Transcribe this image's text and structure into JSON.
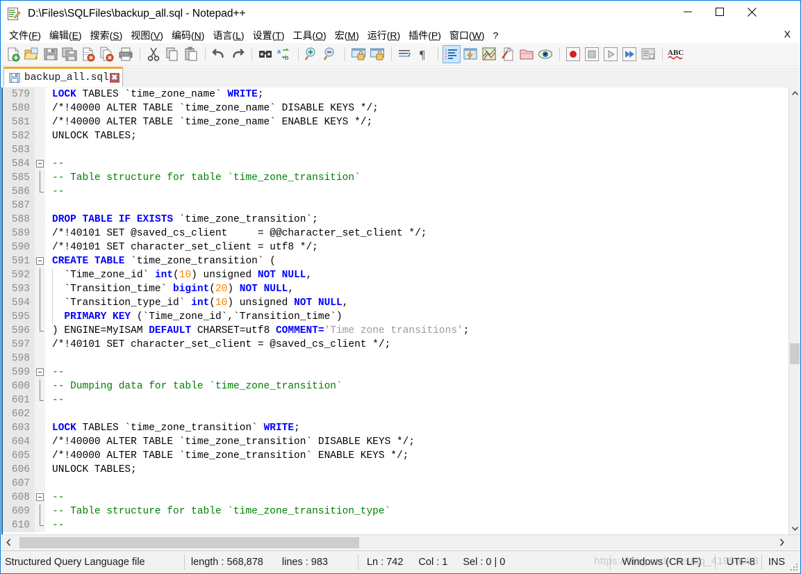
{
  "window": {
    "title": "D:\\Files\\SQLFiles\\backup_all.sql - Notepad++",
    "app_icon": "notepad-plus-plus-icon",
    "minimize_glyph": "—",
    "maximize_glyph": "☐",
    "close_glyph": "✕",
    "accent_color": "#0078d7"
  },
  "menu": {
    "items": [
      {
        "pre": "文件(",
        "key": "F",
        "post": ")"
      },
      {
        "pre": "编辑(",
        "key": "E",
        "post": ")"
      },
      {
        "pre": "搜索(",
        "key": "S",
        "post": ")"
      },
      {
        "pre": "视图(",
        "key": "V",
        "post": ")"
      },
      {
        "pre": "编码(",
        "key": "N",
        "post": ")"
      },
      {
        "pre": "语言(",
        "key": "L",
        "post": ")"
      },
      {
        "pre": "设置(",
        "key": "T",
        "post": ")"
      },
      {
        "pre": "工具(",
        "key": "O",
        "post": ")"
      },
      {
        "pre": "宏(",
        "key": "M",
        "post": ")"
      },
      {
        "pre": "运行(",
        "key": "R",
        "post": ")"
      },
      {
        "pre": "插件(",
        "key": "P",
        "post": ")"
      },
      {
        "pre": "窗口(",
        "key": "W",
        "post": ")"
      },
      {
        "pre": "?",
        "key": "",
        "post": ""
      }
    ],
    "close_document_label": "X"
  },
  "toolbar": {
    "buttons": [
      {
        "name": "new-file-icon",
        "group": 1
      },
      {
        "name": "open-file-icon",
        "group": 1
      },
      {
        "name": "save-icon",
        "group": 1
      },
      {
        "name": "save-all-icon",
        "group": 1
      },
      {
        "name": "close-file-icon",
        "group": 1
      },
      {
        "name": "close-all-files-icon",
        "group": 1
      },
      {
        "name": "print-icon",
        "group": 1
      },
      {
        "name": "cut-icon",
        "group": 2
      },
      {
        "name": "copy-icon",
        "group": 2
      },
      {
        "name": "paste-icon",
        "group": 2
      },
      {
        "name": "undo-icon",
        "group": 3
      },
      {
        "name": "redo-icon",
        "group": 3
      },
      {
        "name": "find-icon",
        "group": 4
      },
      {
        "name": "replace-icon",
        "group": 4
      },
      {
        "name": "zoom-in-icon",
        "group": 5
      },
      {
        "name": "zoom-out-icon",
        "group": 5
      },
      {
        "name": "sync-vertical-scroll-icon",
        "group": 6
      },
      {
        "name": "sync-horizontal-scroll-icon",
        "group": 6
      },
      {
        "name": "word-wrap-icon",
        "group": 7
      },
      {
        "name": "show-all-characters-icon",
        "group": 7
      },
      {
        "name": "indent-guide-icon",
        "group": 8,
        "active": true
      },
      {
        "name": "user-defined-language-icon",
        "group": 8
      },
      {
        "name": "document-map-icon",
        "group": 8
      },
      {
        "name": "function-list-icon",
        "group": 8
      },
      {
        "name": "folder-as-workspace-icon",
        "group": 8
      },
      {
        "name": "monitoring-icon",
        "group": 8
      },
      {
        "name": "record-macro-icon",
        "group": 9
      },
      {
        "name": "stop-recording-icon",
        "group": 9
      },
      {
        "name": "play-macro-icon",
        "group": 9
      },
      {
        "name": "run-macro-multiple-icon",
        "group": 9
      },
      {
        "name": "save-macro-icon",
        "group": 9
      },
      {
        "name": "spell-check-icon",
        "group": 10
      }
    ]
  },
  "tab": {
    "label": "backup_all.sql",
    "icon": "saved-document-icon",
    "close_glyph": "✖"
  },
  "editor": {
    "first_line": 579,
    "lines": [
      {
        "n": 579,
        "fold": "none",
        "tokens": [
          {
            "t": "LOCK",
            "c": "kw"
          },
          {
            "t": " TABLES `time_zone_name` ",
            "c": "plain"
          },
          {
            "t": "WRITE",
            "c": "kw"
          },
          {
            "t": ";",
            "c": "plain"
          }
        ]
      },
      {
        "n": 580,
        "fold": "none",
        "tokens": [
          {
            "t": "/*!40000 ALTER TABLE `time_zone_name` DISABLE KEYS */;",
            "c": "plain"
          }
        ]
      },
      {
        "n": 581,
        "fold": "none",
        "tokens": [
          {
            "t": "/*!40000 ALTER TABLE `time_zone_name` ENABLE KEYS */;",
            "c": "plain"
          }
        ]
      },
      {
        "n": 582,
        "fold": "none",
        "tokens": [
          {
            "t": "UNLOCK TABLES;",
            "c": "plain"
          }
        ]
      },
      {
        "n": 583,
        "fold": "none",
        "tokens": []
      },
      {
        "n": 584,
        "fold": "head",
        "tokens": [
          {
            "t": "--",
            "c": "cmt"
          }
        ]
      },
      {
        "n": 585,
        "fold": "body",
        "tokens": [
          {
            "t": "-- Table structure for table `time_zone_transition`",
            "c": "cmt"
          }
        ]
      },
      {
        "n": 586,
        "fold": "tail",
        "tokens": [
          {
            "t": "--",
            "c": "cmt"
          }
        ]
      },
      {
        "n": 587,
        "fold": "none",
        "tokens": []
      },
      {
        "n": 588,
        "fold": "none",
        "tokens": [
          {
            "t": "DROP TABLE IF EXISTS",
            "c": "kw"
          },
          {
            "t": " `time_zone_transition`;",
            "c": "plain"
          }
        ]
      },
      {
        "n": 589,
        "fold": "none",
        "tokens": [
          {
            "t": "/*!40101 SET @saved_cs_client     = @@character_set_client */;",
            "c": "plain"
          }
        ]
      },
      {
        "n": 590,
        "fold": "none",
        "tokens": [
          {
            "t": "/*!40101 SET character_set_client = utf8 */;",
            "c": "plain"
          }
        ]
      },
      {
        "n": 591,
        "fold": "head",
        "tokens": [
          {
            "t": "CREATE TABLE",
            "c": "kw"
          },
          {
            "t": " `time_zone_transition` (",
            "c": "plain"
          }
        ]
      },
      {
        "n": 592,
        "fold": "body",
        "tokens": [
          {
            "t": "  `Time_zone_id` ",
            "c": "plain"
          },
          {
            "t": "int",
            "c": "kw"
          },
          {
            "t": "(",
            "c": "plain"
          },
          {
            "t": "10",
            "c": "num"
          },
          {
            "t": ") unsigned ",
            "c": "plain"
          },
          {
            "t": "NOT NULL",
            "c": "kw"
          },
          {
            "t": ",",
            "c": "plain"
          }
        ]
      },
      {
        "n": 593,
        "fold": "body",
        "tokens": [
          {
            "t": "  `Transition_time` ",
            "c": "plain"
          },
          {
            "t": "bigint",
            "c": "kw"
          },
          {
            "t": "(",
            "c": "plain"
          },
          {
            "t": "20",
            "c": "num"
          },
          {
            "t": ") ",
            "c": "plain"
          },
          {
            "t": "NOT NULL",
            "c": "kw"
          },
          {
            "t": ",",
            "c": "plain"
          }
        ]
      },
      {
        "n": 594,
        "fold": "body",
        "tokens": [
          {
            "t": "  `Transition_type_id` ",
            "c": "plain"
          },
          {
            "t": "int",
            "c": "kw"
          },
          {
            "t": "(",
            "c": "plain"
          },
          {
            "t": "10",
            "c": "num"
          },
          {
            "t": ") unsigned ",
            "c": "plain"
          },
          {
            "t": "NOT NULL",
            "c": "kw"
          },
          {
            "t": ",",
            "c": "plain"
          }
        ]
      },
      {
        "n": 595,
        "fold": "body",
        "tokens": [
          {
            "t": "  ",
            "c": "plain"
          },
          {
            "t": "PRIMARY KEY",
            "c": "kw"
          },
          {
            "t": " (`Time_zone_id`,`Transition_time`)",
            "c": "plain"
          }
        ]
      },
      {
        "n": 596,
        "fold": "tail",
        "tokens": [
          {
            "t": ") ENGINE=MyISAM ",
            "c": "plain"
          },
          {
            "t": "DEFAULT",
            "c": "kw"
          },
          {
            "t": " CHARSET=utf8 ",
            "c": "plain"
          },
          {
            "t": "COMMENT=",
            "c": "kw"
          },
          {
            "t": "'Time zone transitions'",
            "c": "str"
          },
          {
            "t": ";",
            "c": "plain"
          }
        ]
      },
      {
        "n": 597,
        "fold": "none",
        "tokens": [
          {
            "t": "/*!40101 SET character_set_client = @saved_cs_client */;",
            "c": "plain"
          }
        ]
      },
      {
        "n": 598,
        "fold": "none",
        "tokens": []
      },
      {
        "n": 599,
        "fold": "head",
        "tokens": [
          {
            "t": "--",
            "c": "cmt"
          }
        ]
      },
      {
        "n": 600,
        "fold": "body",
        "tokens": [
          {
            "t": "-- Dumping data for table `time_zone_transition`",
            "c": "cmt"
          }
        ]
      },
      {
        "n": 601,
        "fold": "tail",
        "tokens": [
          {
            "t": "--",
            "c": "cmt"
          }
        ]
      },
      {
        "n": 602,
        "fold": "none",
        "tokens": []
      },
      {
        "n": 603,
        "fold": "none",
        "tokens": [
          {
            "t": "LOCK",
            "c": "kw"
          },
          {
            "t": " TABLES `time_zone_transition` ",
            "c": "plain"
          },
          {
            "t": "WRITE",
            "c": "kw"
          },
          {
            "t": ";",
            "c": "plain"
          }
        ]
      },
      {
        "n": 604,
        "fold": "none",
        "tokens": [
          {
            "t": "/*!40000 ALTER TABLE `time_zone_transition` DISABLE KEYS */;",
            "c": "plain"
          }
        ]
      },
      {
        "n": 605,
        "fold": "none",
        "tokens": [
          {
            "t": "/*!40000 ALTER TABLE `time_zone_transition` ENABLE KEYS */;",
            "c": "plain"
          }
        ]
      },
      {
        "n": 606,
        "fold": "none",
        "tokens": [
          {
            "t": "UNLOCK TABLES;",
            "c": "plain"
          }
        ]
      },
      {
        "n": 607,
        "fold": "none",
        "tokens": []
      },
      {
        "n": 608,
        "fold": "head",
        "tokens": [
          {
            "t": "--",
            "c": "cmt"
          }
        ]
      },
      {
        "n": 609,
        "fold": "body",
        "tokens": [
          {
            "t": "-- Table structure for table `time_zone_transition_type`",
            "c": "cmt"
          }
        ]
      },
      {
        "n": 610,
        "fold": "tail",
        "tokens": [
          {
            "t": "--",
            "c": "cmt"
          }
        ]
      }
    ]
  },
  "scrollbars": {
    "vertical_up_glyph": "▲",
    "vertical_down_glyph": "▼",
    "horizontal_left_glyph": "‹",
    "horizontal_right_glyph": "›"
  },
  "statusbar": {
    "doc_type": "Structured Query Language file",
    "length_label": "length : 568,878",
    "lines_label": "lines : 983",
    "ln": "Ln : 742",
    "col": "Col : 1",
    "sel": "Sel : 0 | 0",
    "eol": "Windows (CR LF)",
    "encoding": "UTF-8",
    "insert_mode": "INS"
  },
  "watermark": {
    "text": "https://blog.csdn.net/qq_41956998"
  }
}
